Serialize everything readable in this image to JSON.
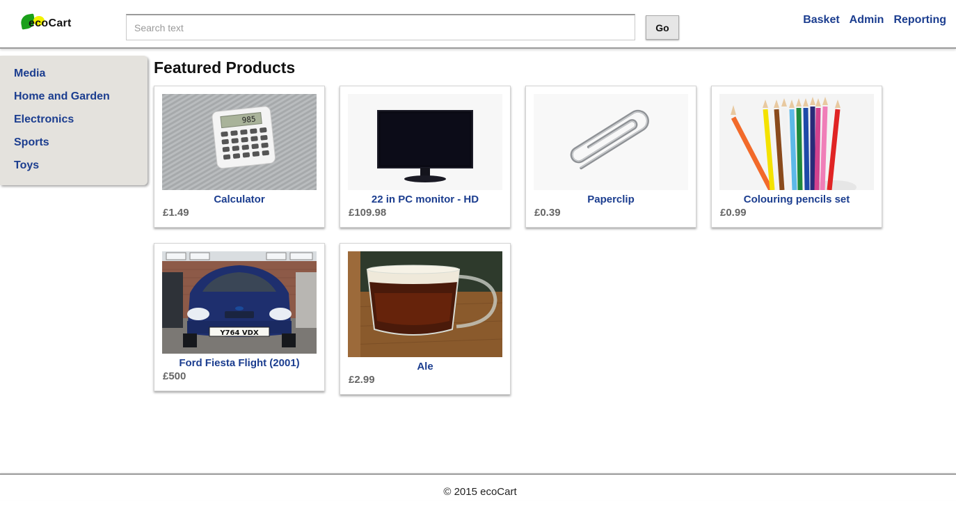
{
  "header": {
    "logo_text": "ecoCart",
    "search_placeholder": "Search text",
    "search_value": "",
    "go_label": "Go",
    "links": [
      "Basket",
      "Admin",
      "Reporting"
    ]
  },
  "sidebar": {
    "items": [
      {
        "label": "Media"
      },
      {
        "label": "Home and Garden"
      },
      {
        "label": "Electronics"
      },
      {
        "label": "Sports"
      },
      {
        "label": "Toys"
      }
    ]
  },
  "main": {
    "title": "Featured Products",
    "products": [
      {
        "name": "Calculator",
        "price": "£1.49",
        "image": "calculator-image"
      },
      {
        "name": "22 in PC monitor - HD",
        "price": "£109.98",
        "image": "monitor-image"
      },
      {
        "name": "Paperclip",
        "price": "£0.39",
        "image": "paperclip-image"
      },
      {
        "name": "Colouring pencils set",
        "price": "£0.99",
        "image": "pencils-image"
      },
      {
        "name": "Ford Fiesta Flight (2001)",
        "price": "£500",
        "image": "car-image"
      },
      {
        "name": "Ale",
        "price": "£2.99",
        "image": "ale-image"
      }
    ]
  },
  "footer": {
    "text": "© 2015 ecoCart"
  },
  "colors": {
    "link": "#1b3d8f",
    "price": "#666666",
    "sidebar_bg": "#e4e2dd"
  }
}
